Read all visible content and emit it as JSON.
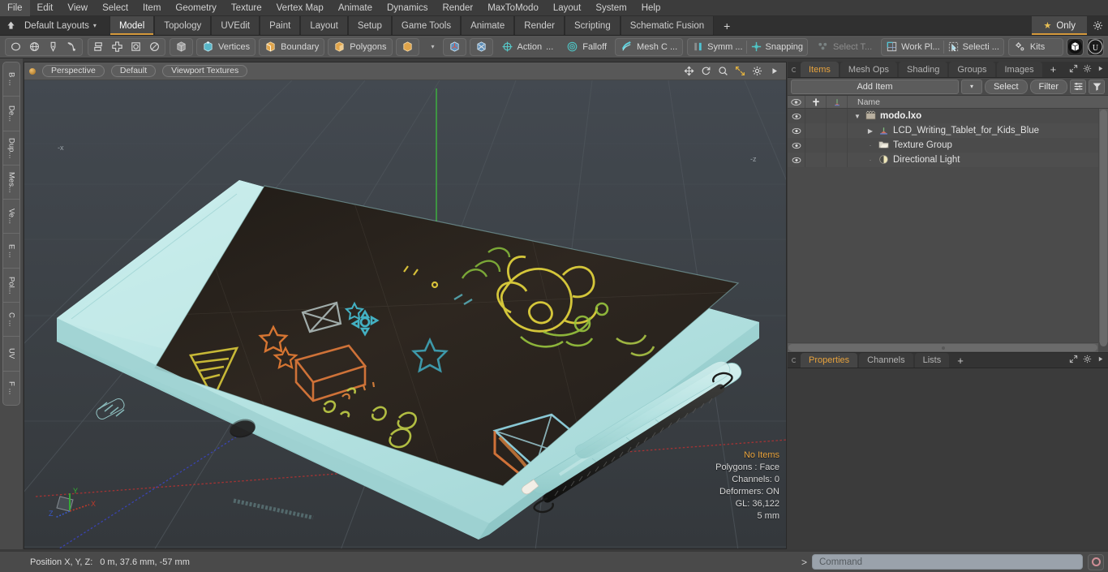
{
  "app": {
    "title": "modo",
    "accent": "#e8a33d",
    "toolbar_bg": "#545454"
  },
  "menubar": {
    "items": [
      {
        "label": "File"
      },
      {
        "label": "Edit"
      },
      {
        "label": "View"
      },
      {
        "label": "Select"
      },
      {
        "label": "Item"
      },
      {
        "label": "Geometry"
      },
      {
        "label": "Texture"
      },
      {
        "label": "Vertex Map"
      },
      {
        "label": "Animate"
      },
      {
        "label": "Dynamics"
      },
      {
        "label": "Render"
      },
      {
        "label": "MaxToModo"
      },
      {
        "label": "Layout"
      },
      {
        "label": "System"
      },
      {
        "label": "Help"
      }
    ]
  },
  "layoutbar": {
    "home_icon": "home-icon",
    "layouts_label": "Default Layouts",
    "caret": "▾",
    "tabs": [
      {
        "label": "Model",
        "active": true
      },
      {
        "label": "Topology",
        "active": false
      },
      {
        "label": "UVEdit",
        "active": false
      },
      {
        "label": "Paint",
        "active": false
      },
      {
        "label": "Layout",
        "active": false
      },
      {
        "label": "Setup",
        "active": false
      },
      {
        "label": "Game Tools",
        "active": false
      },
      {
        "label": "Animate",
        "active": false
      },
      {
        "label": "Render",
        "active": false
      },
      {
        "label": "Scripting",
        "active": false
      },
      {
        "label": "Schematic Fusion",
        "active": false
      }
    ],
    "add_tab_label": "+",
    "only_label": "Only",
    "star_glyph": "★",
    "gear_glyph": "⚙"
  },
  "toolbar": {
    "shape_tools": [
      "circle-icon",
      "sphere-icon",
      "pen-nib-icon",
      "curve-icon"
    ],
    "transform_tools": [
      "stack-icon",
      "move-icon",
      "square-circle-icon",
      "ellipse-icon"
    ],
    "cube_tool": "cube-icon",
    "selection_modes": [
      {
        "label": "Vertices",
        "icon": "vertices-icon"
      },
      {
        "label": "Boundary",
        "icon": "boundary-icon"
      },
      {
        "label": "Polygons",
        "icon": "polygons-icon"
      }
    ],
    "mode_extra_icon": "cube-small-icon",
    "mode_caret": "▾",
    "snap_icons": [
      "axis-snap-icon",
      "axis-snap2-icon"
    ],
    "items": [
      {
        "label": "Action",
        "icon": "action-icon",
        "suffix": "...",
        "dim": false
      },
      {
        "label": "Falloff",
        "icon": "falloff-icon",
        "suffix": "",
        "dim": false
      },
      {
        "label": "Mesh C ...",
        "icon": "mesh-constraint-icon",
        "suffix": "",
        "dim": false
      },
      {
        "label": "Symm ...",
        "icon": "symmetry-icon",
        "suffix": "",
        "dim": false
      },
      {
        "label": "Snapping",
        "icon": "snapping-icon",
        "suffix": "",
        "dim": false
      },
      {
        "label": "Select T...",
        "icon": "select-through-icon",
        "suffix": "",
        "dim": true
      },
      {
        "label": "Work Pl...",
        "icon": "work-plane-icon",
        "suffix": "",
        "dim": false
      },
      {
        "label": "Selecti ...",
        "icon": "selection-icon",
        "suffix": "",
        "dim": false
      }
    ],
    "kits_label": "Kits",
    "kits_icon": "gears-icon",
    "right_icons": [
      "modo-logo-icon",
      "unreal-logo-icon"
    ]
  },
  "left_toolbar": {
    "items": [
      {
        "label": "B ..."
      },
      {
        "label": "De..."
      },
      {
        "label": "Dup..."
      },
      {
        "label": "Mes..."
      },
      {
        "label": "Ve..."
      },
      {
        "label": "E ..."
      },
      {
        "label": "Pol..."
      },
      {
        "label": "C ..."
      },
      {
        "label": "UV"
      },
      {
        "label": "F ..."
      }
    ]
  },
  "viewport": {
    "status_dot_color": "#d9a348",
    "pills": [
      {
        "label": "Perspective"
      },
      {
        "label": "Default"
      },
      {
        "label": "Viewport Textures"
      }
    ],
    "controls": [
      "pan-icon",
      "rotate-icon",
      "zoom-icon",
      "fit-icon",
      "gear-icon",
      "play-icon"
    ],
    "stats": {
      "items_label": "No Items",
      "polygons": "Polygons : Face",
      "channels": "Channels: 0",
      "deformers": "Deformers: ON",
      "gl": "GL: 36,122",
      "scale": "5 mm"
    },
    "axis_gizmo": {
      "x": "X",
      "y": "Y",
      "z": "Z",
      "x_color": "#c0392b",
      "y_color": "#33b233",
      "z_color": "#3858c8"
    },
    "scene": {
      "model_name": "LCD Writing Tablet for Kids (Blue)",
      "body_color": "#b5e3e3",
      "screen_color": "#2b2520",
      "grid_color": "#4a5055",
      "x_axis_color": "#c62f2f",
      "y_axis_color": "#3ec23e",
      "z_axis_color": "#3344cc"
    }
  },
  "items_panel": {
    "tabs": [
      {
        "label": "Items",
        "active": true
      },
      {
        "label": "Mesh Ops",
        "active": false
      },
      {
        "label": "Shading",
        "active": false
      },
      {
        "label": "Groups",
        "active": false
      },
      {
        "label": "Images",
        "active": false
      }
    ],
    "add_tab_label": "+",
    "header_icons": [
      "expand-icon",
      "gear-icon",
      "play-icon"
    ],
    "add_item_label": "Add Item",
    "add_item_caret": "▾",
    "select_label": "Select",
    "filter_label": "Filter",
    "list_tool_icons": [
      "list-options-icon",
      "funnel-icon"
    ],
    "columns": {
      "eye": "eye-icon",
      "lock": "lock-icon",
      "material": "material-icon",
      "name": "Name"
    },
    "rows": [
      {
        "label": "modo.lxo",
        "icon": "scene-icon",
        "depth": 0,
        "twirl": "▼",
        "bold": true
      },
      {
        "label": "LCD_Writing_Tablet_for_Kids_Blue",
        "icon": "mesh-icon",
        "depth": 1,
        "twirl": "▶",
        "bold": false
      },
      {
        "label": "Texture Group",
        "icon": "folder-icon",
        "depth": 1,
        "twirl": "",
        "bold": false
      },
      {
        "label": "Directional Light",
        "icon": "light-icon",
        "depth": 1,
        "twirl": "",
        "bold": false
      }
    ]
  },
  "properties_panel": {
    "tabs": [
      {
        "label": "Properties",
        "active": true
      },
      {
        "label": "Channels",
        "active": false
      },
      {
        "label": "Lists",
        "active": false
      }
    ],
    "add_tab_label": "+",
    "header_icons": [
      "expand-icon",
      "gear-icon",
      "play-icon"
    ]
  },
  "statusbar": {
    "position_label": "Position X, Y, Z:",
    "position_value": "0 m, 37.6 mm, -57 mm",
    "command_prompt": ">",
    "command_placeholder": "Command",
    "record_icon": "record-icon"
  }
}
